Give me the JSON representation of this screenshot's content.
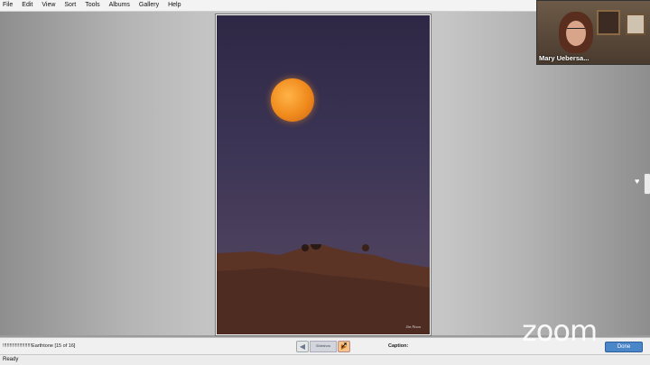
{
  "menu": [
    "File",
    "Edit",
    "View",
    "Sort",
    "Tools",
    "Albums",
    "Gallery",
    "Help"
  ],
  "video": {
    "participant_name": "Mary Uebersa..."
  },
  "photo": {
    "signature": "Jim Nixon"
  },
  "bottom": {
    "photo_info": "!!!!!!!!!!!!!!!!!!!!!Earthtone  [15 of 16]",
    "slideshow_label": "Slideshow",
    "caption_label": "Caption:",
    "done_label": "Done"
  },
  "zoom_logo": "zoom",
  "status": "Ready",
  "icons": {
    "prev": "arrow-left-icon",
    "next": "arrow-right-icon",
    "heart": "heart-icon"
  }
}
